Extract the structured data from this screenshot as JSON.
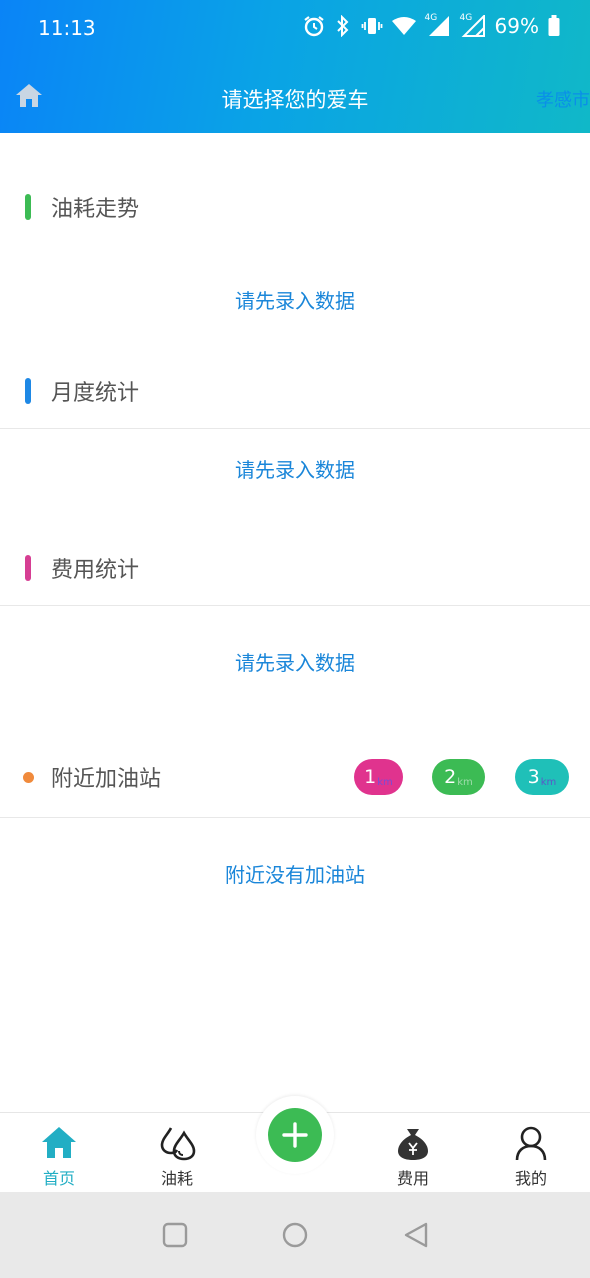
{
  "status_bar": {
    "time": "11:13",
    "battery": "69%",
    "network_4g_a": "4G",
    "network_4g_b": "4G"
  },
  "header": {
    "title": "请选择您的爱车",
    "city": "孝感市"
  },
  "sections": {
    "fuel_trend": {
      "title": "油耗走势",
      "empty": "请先录入数据",
      "color": "#3cbb54"
    },
    "monthly": {
      "title": "月度统计",
      "empty": "请先录入数据",
      "color": "#1e88e5"
    },
    "cost": {
      "title": "费用统计",
      "empty": "请先录入数据",
      "color": "#d63e93"
    },
    "stations": {
      "title": "附近加油站",
      "empty": "附近没有加油站",
      "color": "#f08a3c"
    }
  },
  "distance_filters": [
    {
      "value": "1",
      "unit": "km",
      "color": "#e0338e"
    },
    {
      "value": "2",
      "unit": "km",
      "color": "#3cbb54"
    },
    {
      "value": "3",
      "unit": "km",
      "color": "#1fc0b8"
    }
  ],
  "tabbar": {
    "items": [
      {
        "label": "首页",
        "icon": "home-icon",
        "active": true
      },
      {
        "label": "油耗",
        "icon": "drops-icon",
        "active": false
      },
      {
        "label": "费用",
        "icon": "money-bag-icon",
        "active": false
      },
      {
        "label": "我的",
        "icon": "user-icon",
        "active": false
      }
    ],
    "add_icon": "plus-icon",
    "accent": "#22aec4"
  },
  "system_nav": {
    "icons": [
      "square-icon",
      "circle-icon",
      "triangle-back-icon"
    ]
  }
}
